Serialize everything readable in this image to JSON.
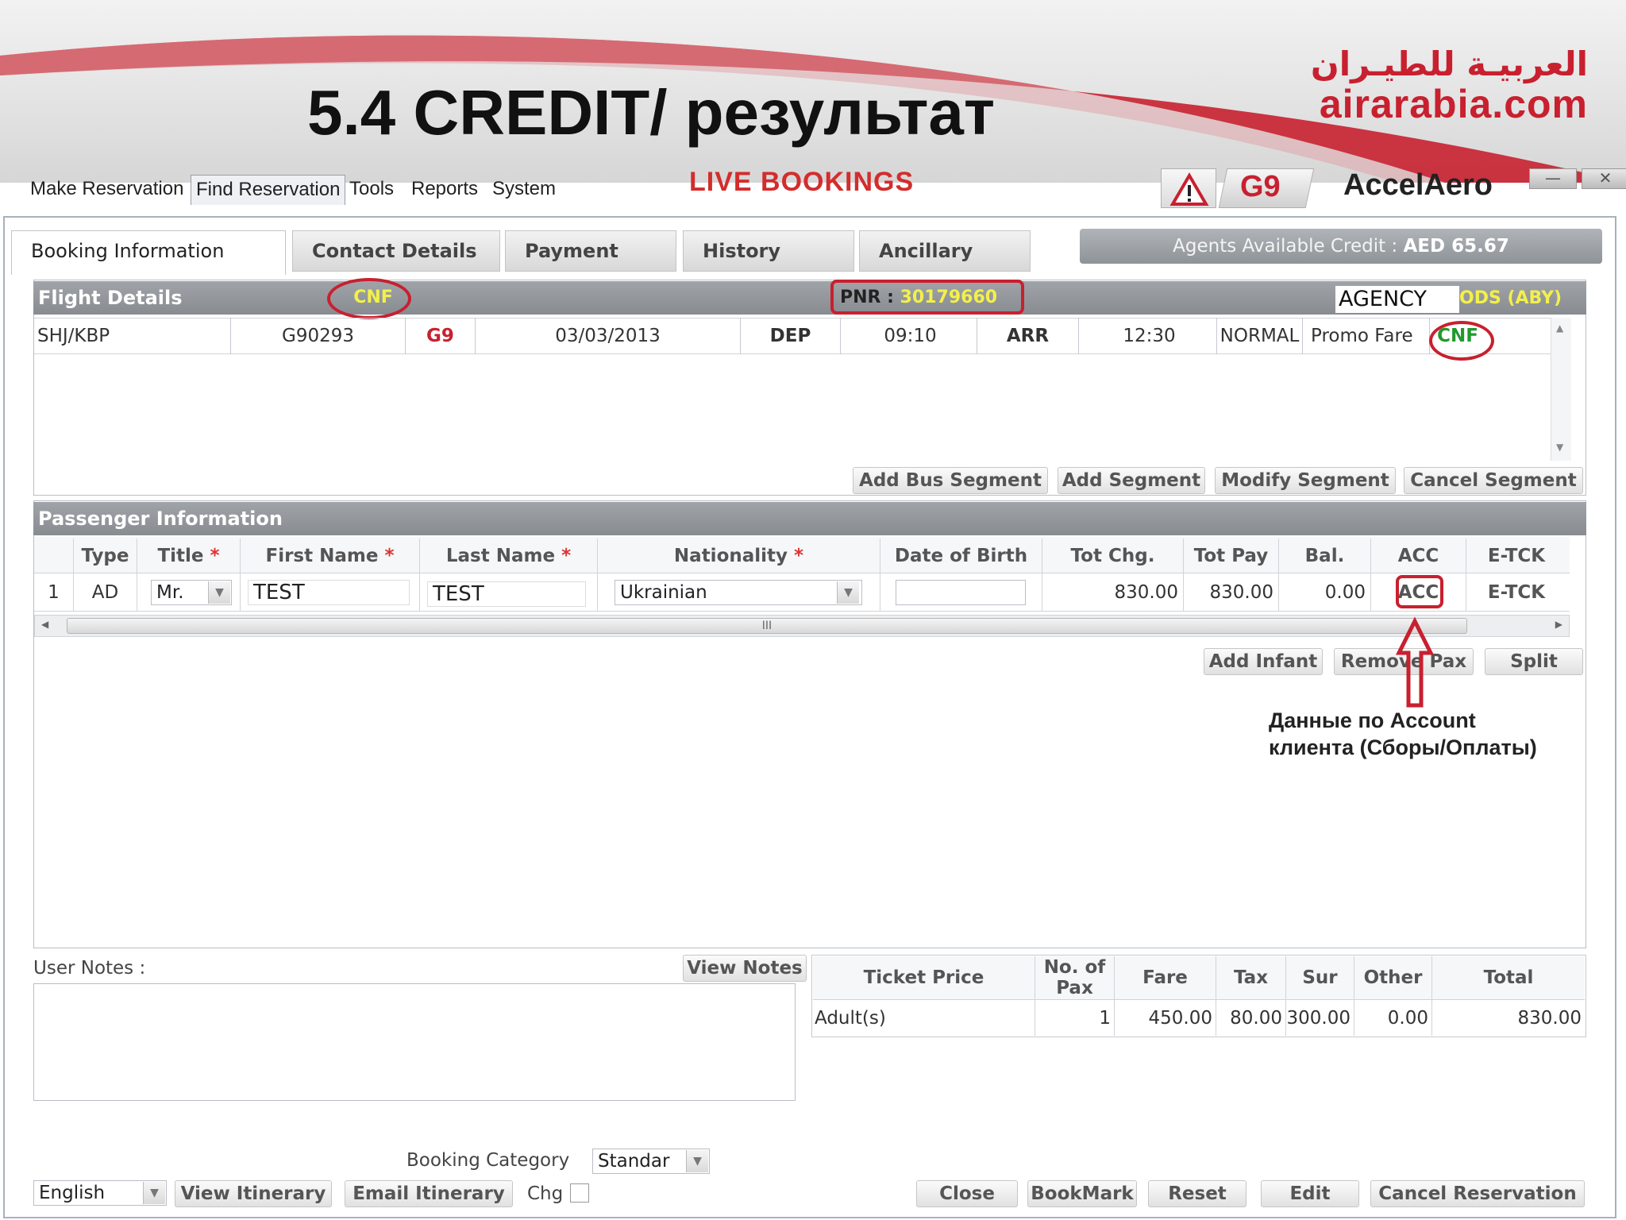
{
  "slide": {
    "title": "5.4 CREDIT/ результат",
    "logo_arabic": "العربيـة للطيـران",
    "logo_latin": "airarabia.com"
  },
  "menu": {
    "items": [
      "Make Reservation",
      "Find Reservation",
      "Tools",
      "Reports",
      "System"
    ],
    "live_bookings": "LIVE BOOKINGS",
    "carrier_code": "G9",
    "brand": "AccelAero",
    "minimize_glyph": "—",
    "close_glyph": "✕"
  },
  "tabs": [
    "Booking Information",
    "Contact Details",
    "Payment",
    "History",
    "Ancillary"
  ],
  "credit": {
    "label": "Agents Available Credit :",
    "value": "AED 65.67"
  },
  "flight_details": {
    "header": "Flight Details",
    "status": "CNF",
    "pnr_label": "PNR :",
    "pnr_value": "30179660",
    "agency_label": "AGENCY",
    "agency_code": "ODS (ABY)",
    "row": {
      "route": "SHJ/KBP",
      "flight_no": "G90293",
      "carrier": "G9",
      "date": "03/03/2013",
      "dep_label": "DEP",
      "dep_time": "09:10",
      "arr_label": "ARR",
      "arr_time": "12:30",
      "class": "NORMAL",
      "fare_type": "Promo Fare",
      "seg_status": "CNF"
    },
    "buttons": [
      "Add Bus Segment",
      "Add Segment",
      "Modify Segment",
      "Cancel Segment"
    ]
  },
  "passenger_info": {
    "header": "Passenger Information",
    "columns": [
      "Type",
      "Title",
      "First Name",
      "Last Name",
      "Nationality",
      "Date of Birth",
      "Tot Chg.",
      "Tot Pay",
      "Bal.",
      "ACC",
      "E-TCK"
    ],
    "required_mark": "*",
    "row": {
      "index": "1",
      "type": "AD",
      "title": "Mr.",
      "first_name": "TEST",
      "last_name": "TEST",
      "nationality": "Ukrainian",
      "dob": "",
      "tot_chg": "830.00",
      "tot_pay": "830.00",
      "bal": "0.00",
      "acc": "ACC",
      "etck": "E-TCK"
    },
    "scroll_thumb": "III",
    "buttons": [
      "Add Infant",
      "Remove Pax",
      "Split"
    ],
    "annotation_line1": "Данные по Account",
    "annotation_line2": "клиента (Сборы/Оплаты)"
  },
  "notes": {
    "label": "User Notes :",
    "view_button": "View Notes"
  },
  "price_table": {
    "headers": [
      "Ticket Price",
      "No. of Pax",
      "Fare",
      "Tax",
      "Sur",
      "Other",
      "Total"
    ],
    "row": [
      "Adult(s)",
      "1",
      "450.00",
      "80.00",
      "300.00",
      "0.00",
      "830.00"
    ]
  },
  "bottom": {
    "booking_category_label": "Booking Category",
    "booking_category_value": "Standar",
    "language": "English",
    "view_itinerary": "View Itinerary",
    "email_itinerary": "Email Itinerary",
    "chg_label": "Chg",
    "actions": [
      "Close",
      "BookMark",
      "Reset",
      "Edit",
      "Cancel Reservation"
    ]
  },
  "colors": {
    "brand_red": "#c8202f",
    "highlight_yellow": "#f3f04a",
    "status_green": "#1f9a2c"
  }
}
